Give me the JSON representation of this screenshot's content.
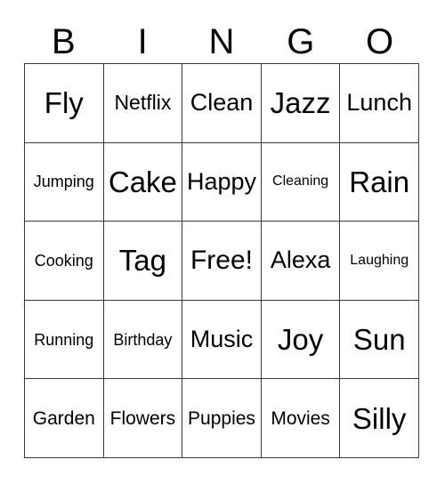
{
  "card": {
    "type": "bingo-card",
    "columns": 5,
    "rows": 5,
    "background_color": "#ffffff",
    "text_color": "#000000",
    "grid_line_color": "#3a3a3a"
  },
  "header": {
    "letters": [
      {
        "label": "B"
      },
      {
        "label": "I"
      },
      {
        "label": "N"
      },
      {
        "label": "G"
      },
      {
        "label": "O"
      }
    ]
  },
  "grid": {
    "cells": [
      {
        "label": "Fly",
        "size": "fs-xl",
        "row": 1,
        "col": 1
      },
      {
        "label": "Netflix",
        "size": "fs-sm",
        "row": 1,
        "col": 2
      },
      {
        "label": "Clean",
        "size": "fs-md",
        "row": 1,
        "col": 3
      },
      {
        "label": "Jazz",
        "size": "fs-xl",
        "row": 1,
        "col": 4
      },
      {
        "label": "Lunch",
        "size": "fs-md",
        "row": 1,
        "col": 5
      },
      {
        "label": "Jumping",
        "size": "fs-xxs",
        "row": 2,
        "col": 1
      },
      {
        "label": "Cake",
        "size": "fs-xl",
        "row": 2,
        "col": 2
      },
      {
        "label": "Happy",
        "size": "fs-md",
        "row": 2,
        "col": 3
      },
      {
        "label": "Cleaning",
        "size": "fs-tiny",
        "row": 2,
        "col": 4
      },
      {
        "label": "Rain",
        "size": "fs-xl",
        "row": 2,
        "col": 5
      },
      {
        "label": "Cooking",
        "size": "fs-xxs",
        "row": 3,
        "col": 1
      },
      {
        "label": "Tag",
        "size": "fs-xl",
        "row": 3,
        "col": 2
      },
      {
        "label": "Free!",
        "size": "fs-lg",
        "row": 3,
        "col": 3
      },
      {
        "label": "Alexa",
        "size": "fs-md",
        "row": 3,
        "col": 4
      },
      {
        "label": "Laughing",
        "size": "fs-tiny",
        "row": 3,
        "col": 5
      },
      {
        "label": "Running",
        "size": "fs-xxs",
        "row": 4,
        "col": 1
      },
      {
        "label": "Birthday",
        "size": "fs-xxs",
        "row": 4,
        "col": 2
      },
      {
        "label": "Music",
        "size": "fs-md",
        "row": 4,
        "col": 3
      },
      {
        "label": "Joy",
        "size": "fs-xl",
        "row": 4,
        "col": 4
      },
      {
        "label": "Sun",
        "size": "fs-xl",
        "row": 4,
        "col": 5
      },
      {
        "label": "Garden",
        "size": "fs-xs",
        "row": 5,
        "col": 1
      },
      {
        "label": "Flowers",
        "size": "fs-xs",
        "row": 5,
        "col": 2
      },
      {
        "label": "Puppies",
        "size": "fs-xs",
        "row": 5,
        "col": 3
      },
      {
        "label": "Movies",
        "size": "fs-xs",
        "row": 5,
        "col": 4
      },
      {
        "label": "Silly",
        "size": "fs-xl",
        "row": 5,
        "col": 5
      }
    ]
  }
}
